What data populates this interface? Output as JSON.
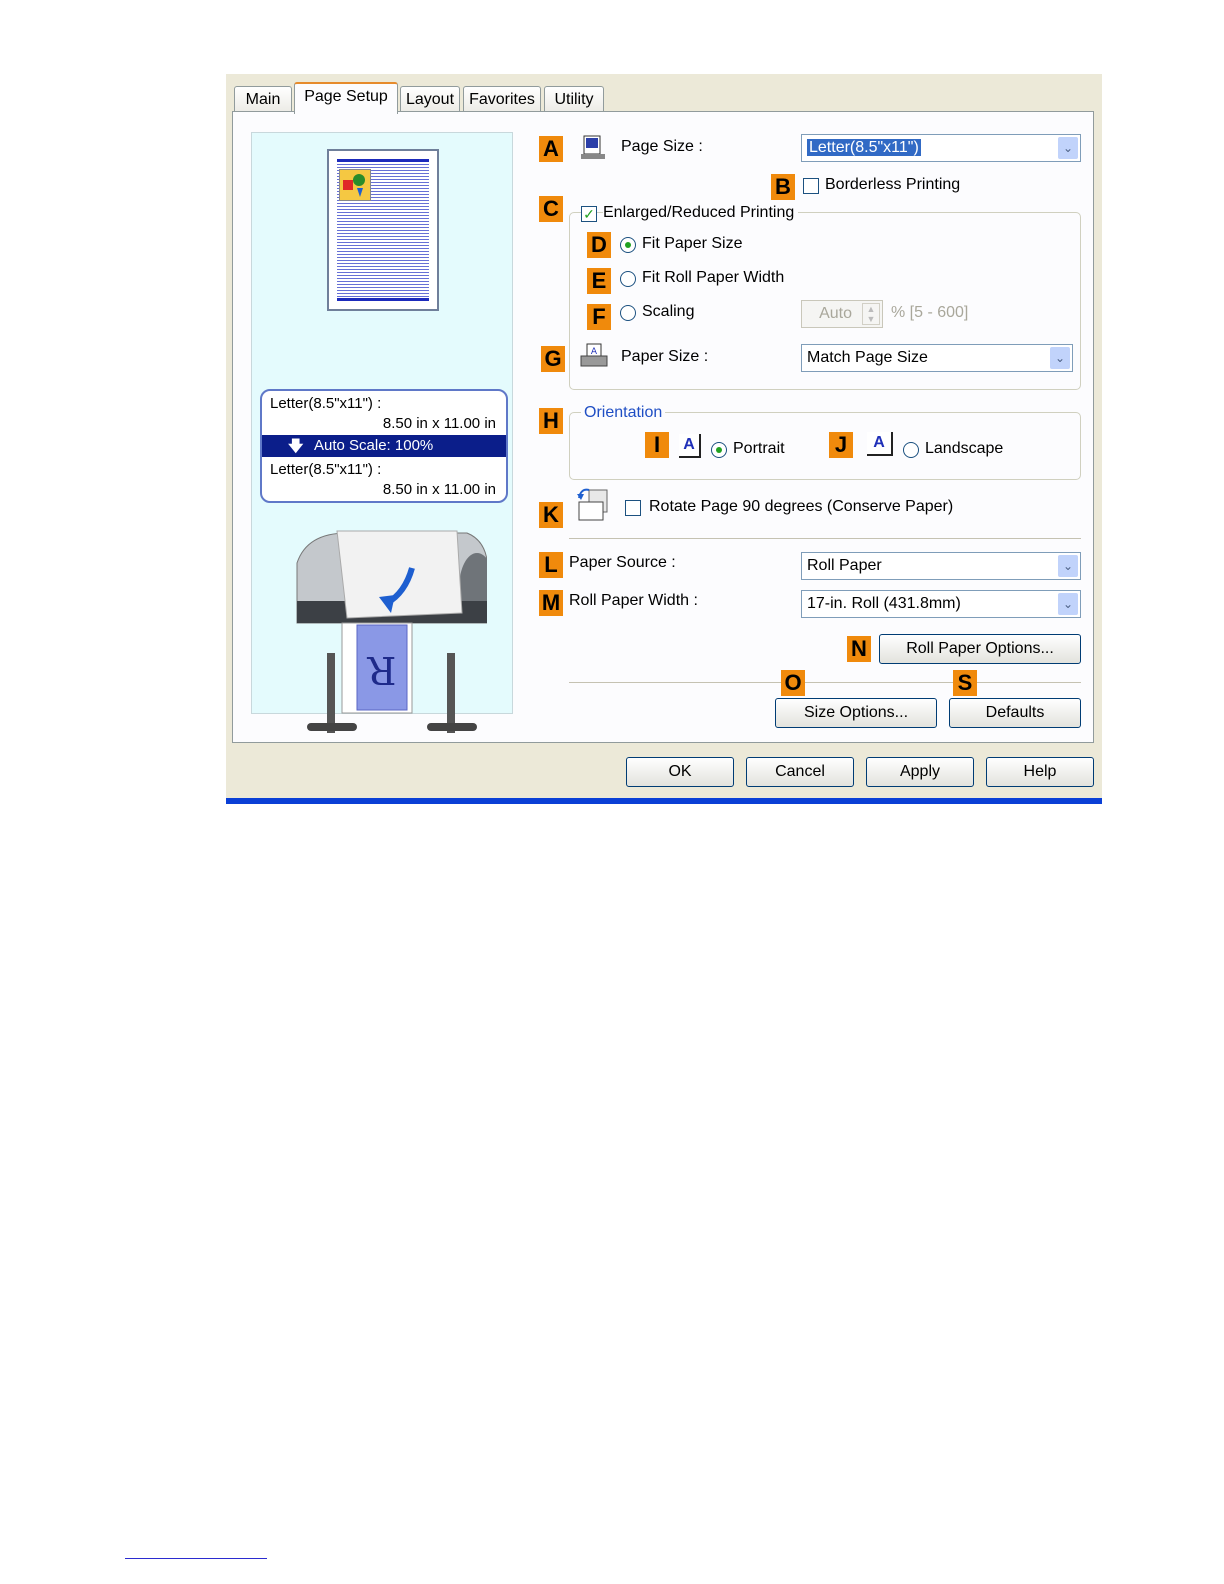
{
  "tabs": [
    "Main",
    "Page Setup",
    "Layout",
    "Favorites",
    "Utility"
  ],
  "preview": {
    "paper_name_1": "Letter(8.5\"x11\") :",
    "paper_dims_1": "8.50 in x 11.00 in",
    "scale_arrow": "🡇",
    "scale_text": "Auto Scale: 100%",
    "paper_name_2": "Letter(8.5\"x11\") :",
    "paper_dims_2": "8.50 in x 11.00 in"
  },
  "markers": {
    "A": "A",
    "B": "B",
    "C": "C",
    "D": "D",
    "E": "E",
    "F": "F",
    "G": "G",
    "H": "H",
    "I": "I",
    "J": "J",
    "K": "K",
    "L": "L",
    "M": "M",
    "N": "N",
    "O": "O",
    "S": "S"
  },
  "page_size": {
    "label": "Page Size :",
    "value": "Letter(8.5\"x11\")"
  },
  "borderless": {
    "label": "Borderless Printing",
    "checked": false
  },
  "enlarged": {
    "label": "Enlarged/Reduced Printing",
    "checked": true
  },
  "fit_paper_size": {
    "label": "Fit Paper Size",
    "selected": true
  },
  "fit_roll_width": {
    "label": "Fit Roll Paper Width",
    "selected": false
  },
  "scaling": {
    "label": "Scaling",
    "value": "Auto",
    "range": "% [5 - 600]"
  },
  "paper_size": {
    "label": "Paper Size :",
    "value": "Match Page Size"
  },
  "orientation": {
    "title": "Orientation",
    "portrait": "Portrait",
    "landscape": "Landscape",
    "icon_letter": "A",
    "selected": "Portrait"
  },
  "rotate": {
    "label": "Rotate Page 90 degrees (Conserve Paper)",
    "checked": false
  },
  "paper_source": {
    "label": "Paper Source :",
    "value": "Roll Paper"
  },
  "roll_width": {
    "label": "Roll Paper Width :",
    "value": "17-in. Roll (431.8mm)"
  },
  "buttons": {
    "roll_options": "Roll Paper Options...",
    "size_options": "Size Options...",
    "defaults": "Defaults",
    "ok": "OK",
    "cancel": "Cancel",
    "apply": "Apply",
    "help": "Help"
  },
  "dropdown_glyph": "⌄",
  "check_glyph": "✓",
  "colors": {
    "marker": "#f08a0c",
    "selection": "#316ac5",
    "title_bar": "#0a3fd6",
    "preview_bg": "#e4fbfd"
  }
}
